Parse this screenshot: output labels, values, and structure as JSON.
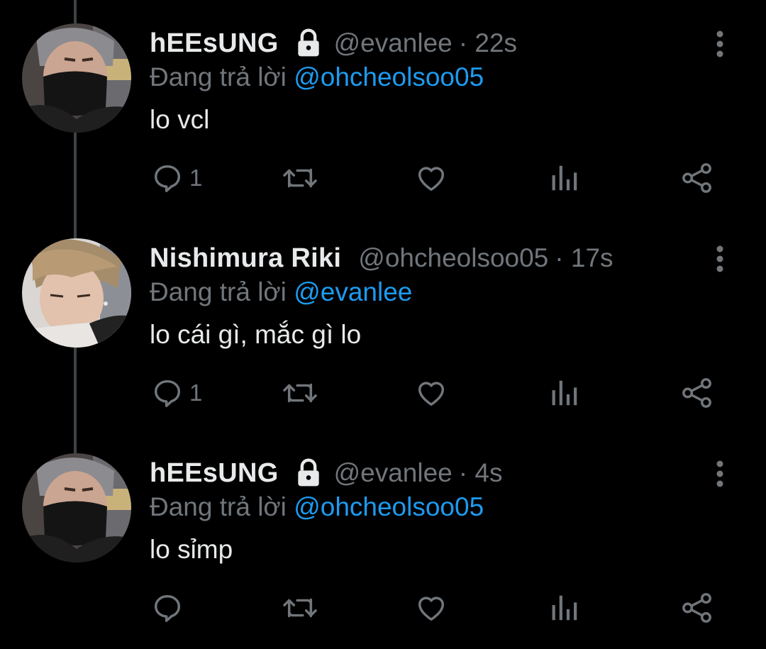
{
  "reply_prefix": "Đang trả lời",
  "tweets": [
    {
      "display_name": "hEEsUNG",
      "locked": true,
      "handle": "@evanlee",
      "time": "· 22s",
      "reply_to": "@ohcheolsoo05",
      "text": "lo vcl",
      "reply_count": "1",
      "avatar": "masked-person-photo"
    },
    {
      "display_name": "Nishimura Riki",
      "locked": false,
      "handle": "@ohcheolsoo05",
      "time": "· 17s",
      "reply_to": "@evanlee",
      "text": "lo cái gì, mắc gì lo",
      "reply_count": "1",
      "avatar": "blond-person-photo"
    },
    {
      "display_name": "hEEsUNG",
      "locked": true,
      "handle": "@evanlee",
      "time": "· 4s",
      "reply_to": "@ohcheolsoo05",
      "text": "lo sỉmp",
      "reply_count": "",
      "avatar": "masked-person-photo"
    }
  ],
  "colors": {
    "background": "#000000",
    "primary_text": "#e7e9ea",
    "secondary_text": "#71767b",
    "accent": "#1d9bf0",
    "thread_line": "#3d4246"
  },
  "icons": [
    "lock-icon",
    "more-options-icon",
    "reply-icon",
    "retweet-icon",
    "like-icon",
    "analytics-icon",
    "share-icon"
  ]
}
